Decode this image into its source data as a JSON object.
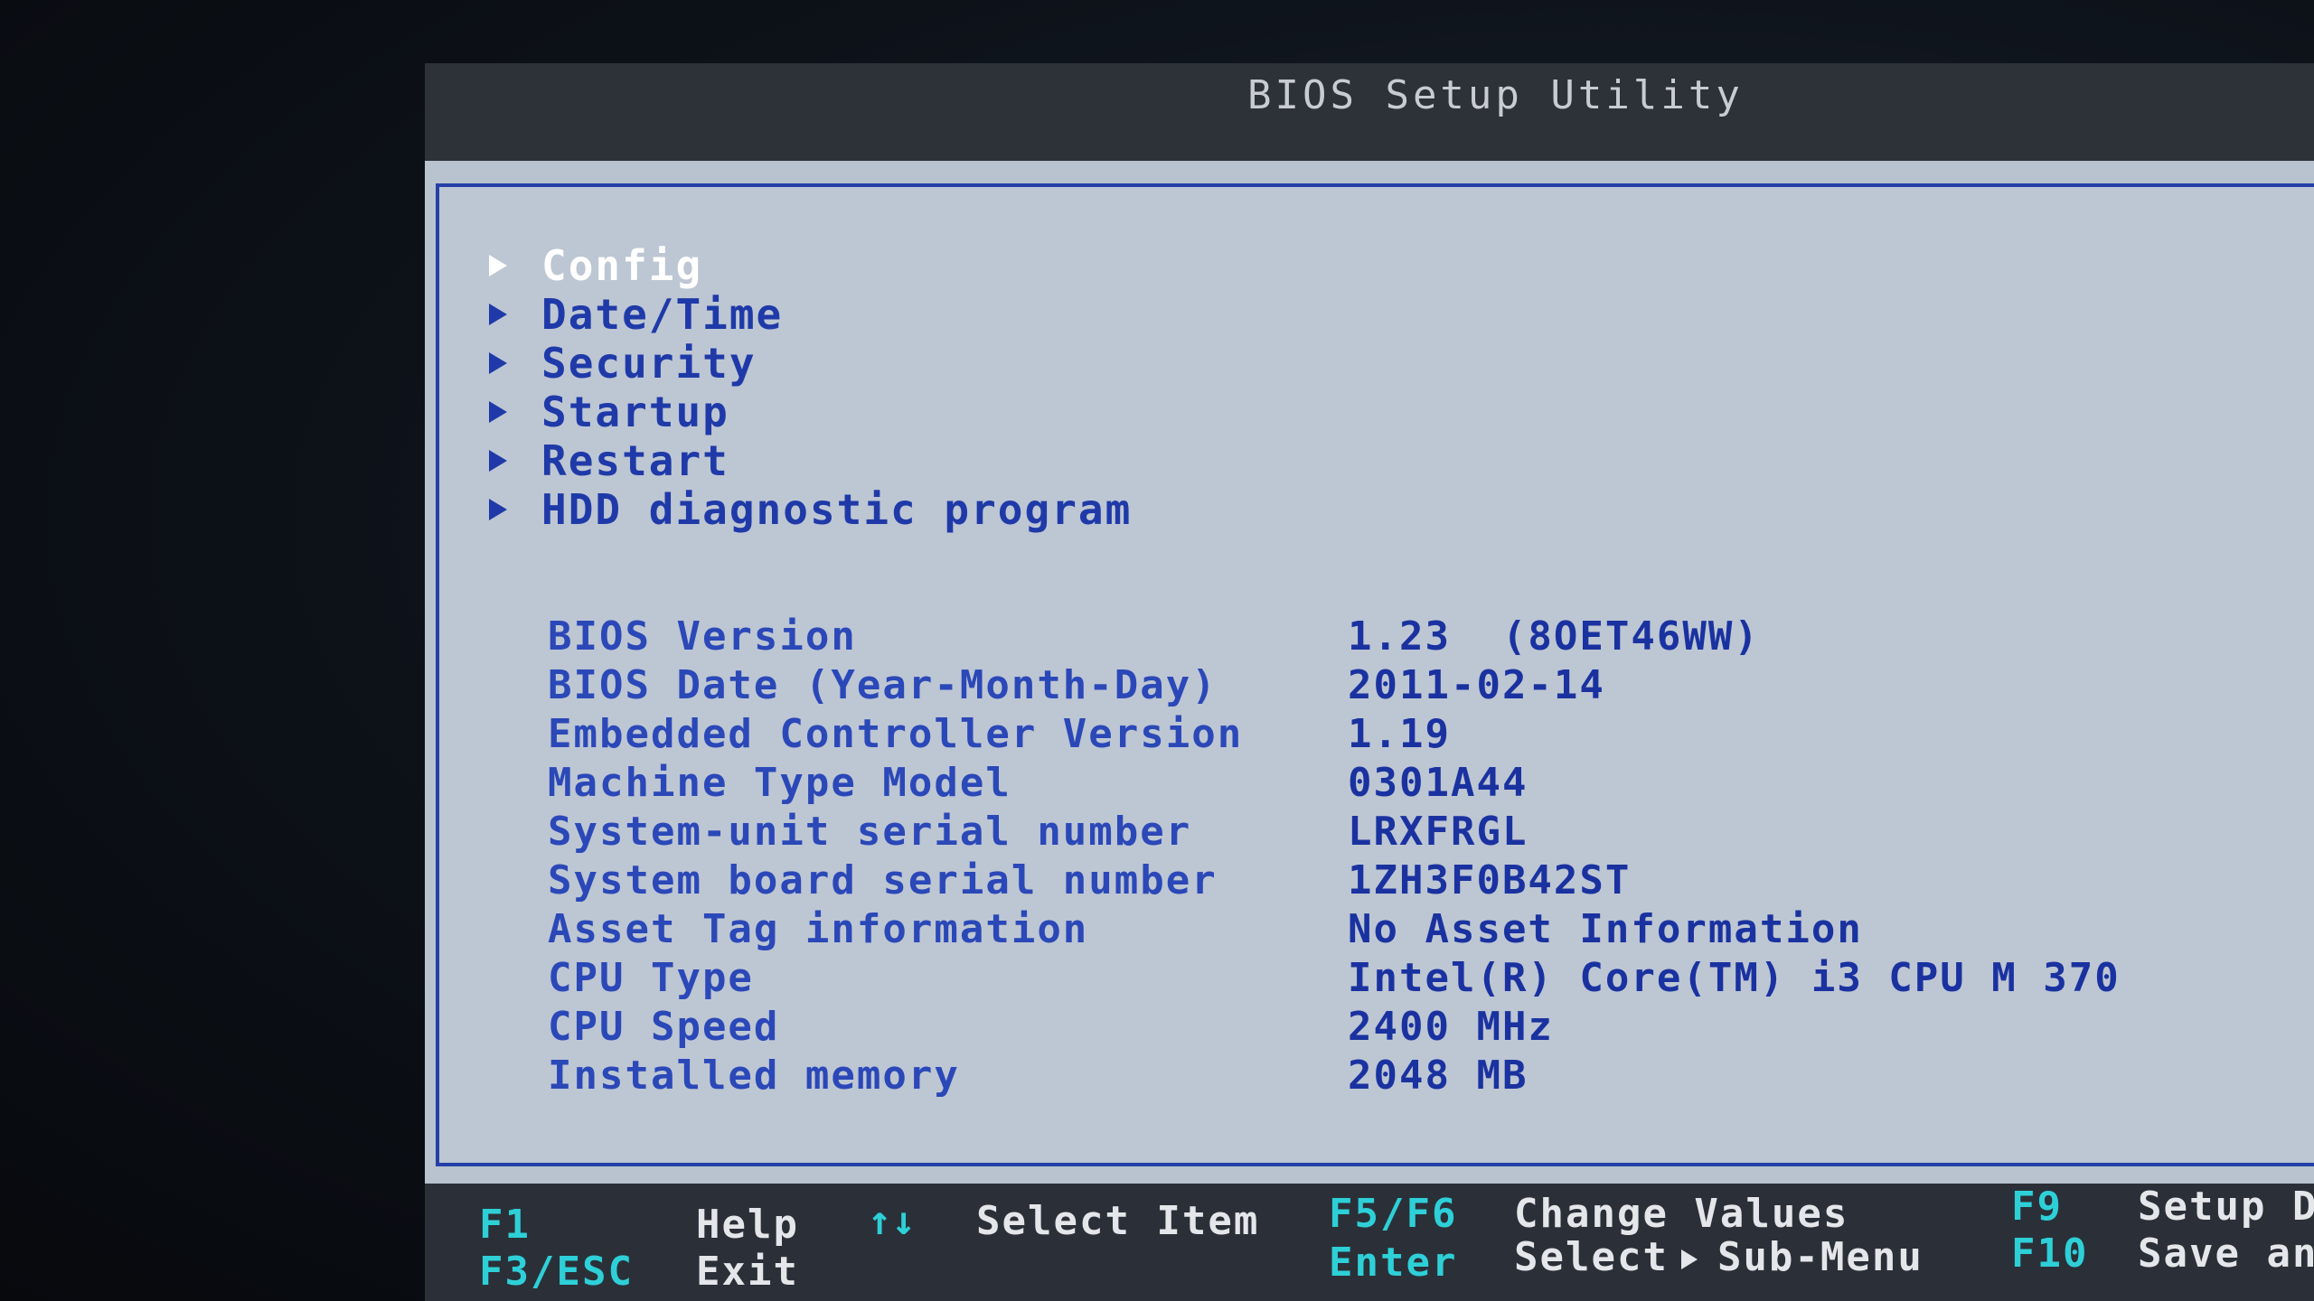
{
  "title": "BIOS Setup Utility",
  "menu": [
    {
      "label": "Config",
      "selected": true
    },
    {
      "label": "Date/Time",
      "selected": false
    },
    {
      "label": "Security",
      "selected": false
    },
    {
      "label": "Startup",
      "selected": false
    },
    {
      "label": "Restart",
      "selected": false
    },
    {
      "label": "HDD diagnostic program",
      "selected": false
    }
  ],
  "info": [
    {
      "label": "BIOS Version",
      "value": "1.23  (8OET46WW)"
    },
    {
      "label": "BIOS Date (Year-Month-Day)",
      "value": "2011-02-14"
    },
    {
      "label": "Embedded Controller Version",
      "value": "1.19"
    },
    {
      "label": "Machine Type Model",
      "value": "0301A44"
    },
    {
      "label": "System-unit serial number",
      "value": "LRXFRGL"
    },
    {
      "label": "System board serial number",
      "value": "1ZH3F0B42ST"
    },
    {
      "label": "Asset Tag information",
      "value": "No Asset Information"
    },
    {
      "label": "CPU Type",
      "value": "Intel(R) Core(TM) i3 CPU M 370"
    },
    {
      "label": "CPU Speed",
      "value": "2400 MHz"
    },
    {
      "label": "Installed memory",
      "value": "2048 MB"
    }
  ],
  "footer": {
    "f1_key": "F1",
    "f1_desc": "Help",
    "f3_key": "F3/ESC",
    "f3_desc": "Exit",
    "arrows_key": "↑↓",
    "arrows_desc": "Select Item",
    "f5_key": "F5/F6",
    "f5_desc": "Change Values",
    "enter_key": "Enter",
    "enter_desc_a": "Select",
    "enter_desc_b": "Sub-Menu",
    "f9_key": "F9",
    "f9_desc": "Setup D",
    "f10_key": "F10",
    "f10_desc": "Save an"
  },
  "colors": {
    "panel": "#bdc6d3",
    "text_blue": "#1f3aa8",
    "key_cyan": "#2ed0d8",
    "frame": "#2440a8"
  }
}
